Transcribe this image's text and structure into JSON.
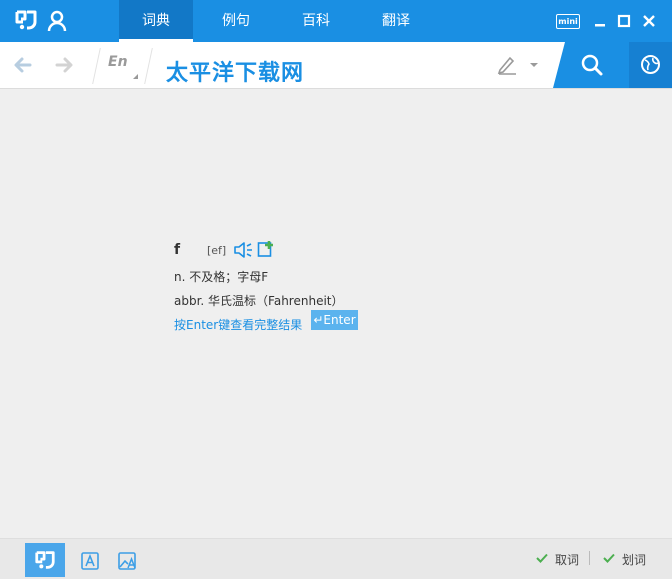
{
  "header": {
    "logo_icon": "app-logo-icon",
    "user_icon": "user-icon",
    "tabs": [
      {
        "label": "词典",
        "active": true
      },
      {
        "label": "例句",
        "active": false
      },
      {
        "label": "百科",
        "active": false
      },
      {
        "label": "翻译",
        "active": false
      }
    ],
    "mini_label": "mini",
    "window_controls": [
      "minimize-icon",
      "maximize-icon",
      "close-icon"
    ]
  },
  "search": {
    "lang_label": "En",
    "query": "太平洋下载网",
    "search_icon": "search-icon",
    "globe_icon": "globe-icon"
  },
  "result": {
    "word": "f",
    "phonetic": "[ef]",
    "definitions": [
      "n. 不及格；字母F",
      "abbr. 华氏温标（Fahrenheit）"
    ],
    "hint": "按Enter键查看完整结果",
    "enter_badge": "↵Enter"
  },
  "footer": {
    "options": [
      {
        "label": "取词",
        "checked": true
      },
      {
        "label": "划词",
        "checked": true
      }
    ]
  },
  "colors": {
    "accent": "#1a8fe3",
    "background": "#efefef",
    "check": "#4caf50"
  }
}
